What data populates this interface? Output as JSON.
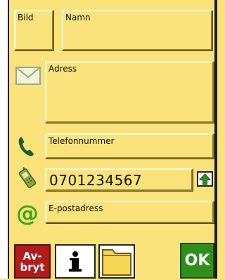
{
  "form": {
    "picture_label": "Bild",
    "name_label": "Namn",
    "address_label": "Adress",
    "phone_label": "Telefonnummer",
    "mobile_value": "0701234567",
    "email_label": "E-postadress"
  },
  "buttons": {
    "cancel_line1": "Av-",
    "cancel_line2": "bryt",
    "ok_label": "OK"
  },
  "icons": {
    "address": "envelope-icon",
    "phone": "phone-handset-icon",
    "mobile": "mobile-phone-icon",
    "email": "at-sign-icon",
    "info": "info-icon",
    "folder": "folder-icon",
    "shift": "shift-up-arrow-icon"
  },
  "colors": {
    "background": "#f9e37a",
    "cancel": "#b01c1c",
    "ok": "#2f8f1a",
    "at_sign": "#3aa61a"
  }
}
